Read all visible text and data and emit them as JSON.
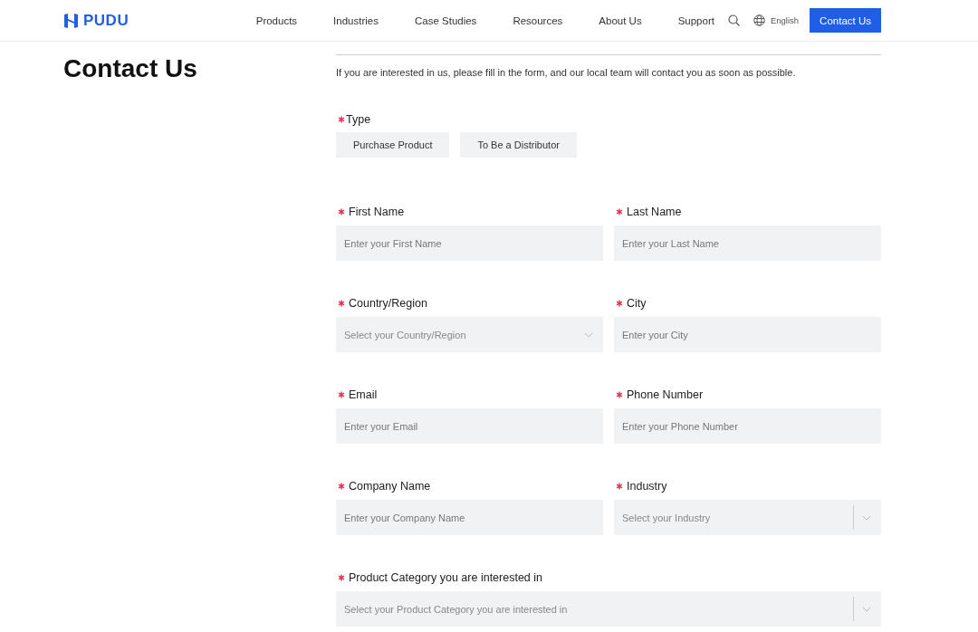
{
  "header": {
    "logo": "PUDU",
    "nav": [
      "Products",
      "Industries",
      "Case Studies",
      "Resources",
      "About Us",
      "Support"
    ],
    "language": "English",
    "cta": "Contact Us"
  },
  "page_title": "Contact Us",
  "intro": "If you are interested in us, please fill in the form, and our local team will contact you as soon as possible.",
  "type_field": {
    "label": "Type",
    "required": true,
    "options": [
      {
        "label": "Purchase Product",
        "selected": false
      },
      {
        "label": "To Be a Distributor",
        "selected": false
      }
    ]
  },
  "rows": [
    [
      {
        "label": "First Name",
        "required": true,
        "kind": "input",
        "placeholder": "Enter your First Name"
      },
      {
        "label": "Last Name",
        "required": true,
        "kind": "input",
        "placeholder": "Enter your Last Name"
      }
    ],
    [
      {
        "label": "Country/Region",
        "required": true,
        "kind": "select",
        "placeholder": "Select your Country/Region"
      },
      {
        "label": "City",
        "required": true,
        "kind": "input",
        "placeholder": "Enter your City"
      }
    ],
    [
      {
        "label": "Email",
        "required": true,
        "kind": "input",
        "placeholder": "Enter your Email"
      },
      {
        "label": "Phone Number",
        "required": true,
        "kind": "input",
        "placeholder": "Enter your Phone Number"
      }
    ],
    [
      {
        "label": "Company Name",
        "required": true,
        "kind": "input",
        "placeholder": "Enter your Company Name"
      },
      {
        "label": "Industry",
        "required": true,
        "kind": "select-divided",
        "placeholder": "Select your Industry"
      }
    ],
    [
      {
        "label": "Product Category you are interested in",
        "required": true,
        "kind": "select-divided",
        "placeholder": "Select your Product Category you are interested in"
      }
    ]
  ]
}
